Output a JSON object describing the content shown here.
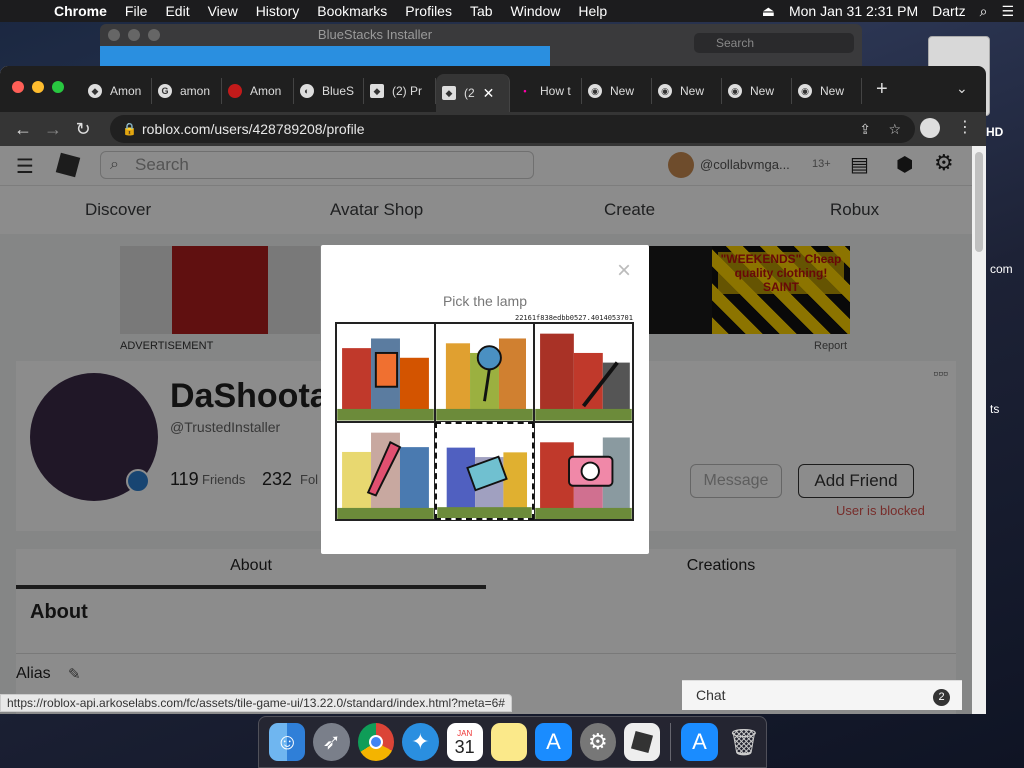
{
  "menubar": {
    "app": "Chrome",
    "items": [
      "File",
      "Edit",
      "View",
      "History",
      "Bookmarks",
      "Profiles",
      "Tab",
      "Window",
      "Help"
    ],
    "datetime": "Mon Jan 31  2:31 PM",
    "user": "Dartz"
  },
  "installer": {
    "title": "BlueStacks Installer",
    "search_placeholder": "Search"
  },
  "desktop": {
    "labels": [
      "HD",
      "com",
      "ts"
    ]
  },
  "tabs": [
    {
      "label": "Amon",
      "icon": "roblox-icon"
    },
    {
      "label": "amon",
      "icon": "google-icon"
    },
    {
      "label": "Amon",
      "icon": "amongus-icon"
    },
    {
      "label": "BlueS",
      "icon": "bluestacks-icon"
    },
    {
      "label": "(2) Pr",
      "icon": "roblox-icon"
    },
    {
      "label": "(2",
      "icon": "roblox-icon",
      "active": true
    },
    {
      "label": "How t",
      "icon": "dot-icon"
    },
    {
      "label": "New",
      "icon": "chrome-icon"
    },
    {
      "label": "New",
      "icon": "chrome-icon"
    },
    {
      "label": "New",
      "icon": "chrome-icon"
    },
    {
      "label": "New",
      "icon": "chrome-icon"
    }
  ],
  "url": "roblox.com/users/428789208/profile",
  "roblox": {
    "search_placeholder": "Search",
    "username": "@collabvmga...",
    "age": "13+",
    "nav": [
      "Discover",
      "Avatar Shop",
      "Create",
      "Robux"
    ],
    "advertisement": "ADVERTISEMENT",
    "report": "Report",
    "ad_right_text": "\"WEEKENDS\" Cheap quality clothing! SAINT",
    "profile": {
      "name": "DaShoota",
      "handle": "@TrustedInstaller",
      "friends_count": "119",
      "friends_label": "Friends",
      "followers_count": "232",
      "followers_label": "Fol",
      "message": "Message",
      "add_friend": "Add Friend",
      "blocked": "User is blocked"
    },
    "tabs": [
      "About",
      "Creations"
    ],
    "about_title": "About",
    "alias": "Alias"
  },
  "captcha": {
    "prompt": "Pick the lamp",
    "hash": "22161f838edbb0527.4014053701",
    "close": "×"
  },
  "status_url": "https://roblox-api.arkoselabs.com/fc/assets/tile-game-ui/13.22.0/standard/index.html?meta=6#",
  "chat": {
    "label": "Chat",
    "badge": "2"
  },
  "dock": {
    "apps": [
      "finder-icon",
      "launchpad-icon",
      "chrome-icon",
      "safari-icon",
      "calendar-icon",
      "notes-icon",
      "appstore-icon",
      "settings-icon",
      "roblox-icon",
      "appstore-icon",
      "trash-icon"
    ],
    "calendar_month": "JAN",
    "calendar_day": "31"
  },
  "colors": {
    "roblox_blocked": "#d9534f",
    "installer_progress": "#2a8fe0"
  }
}
